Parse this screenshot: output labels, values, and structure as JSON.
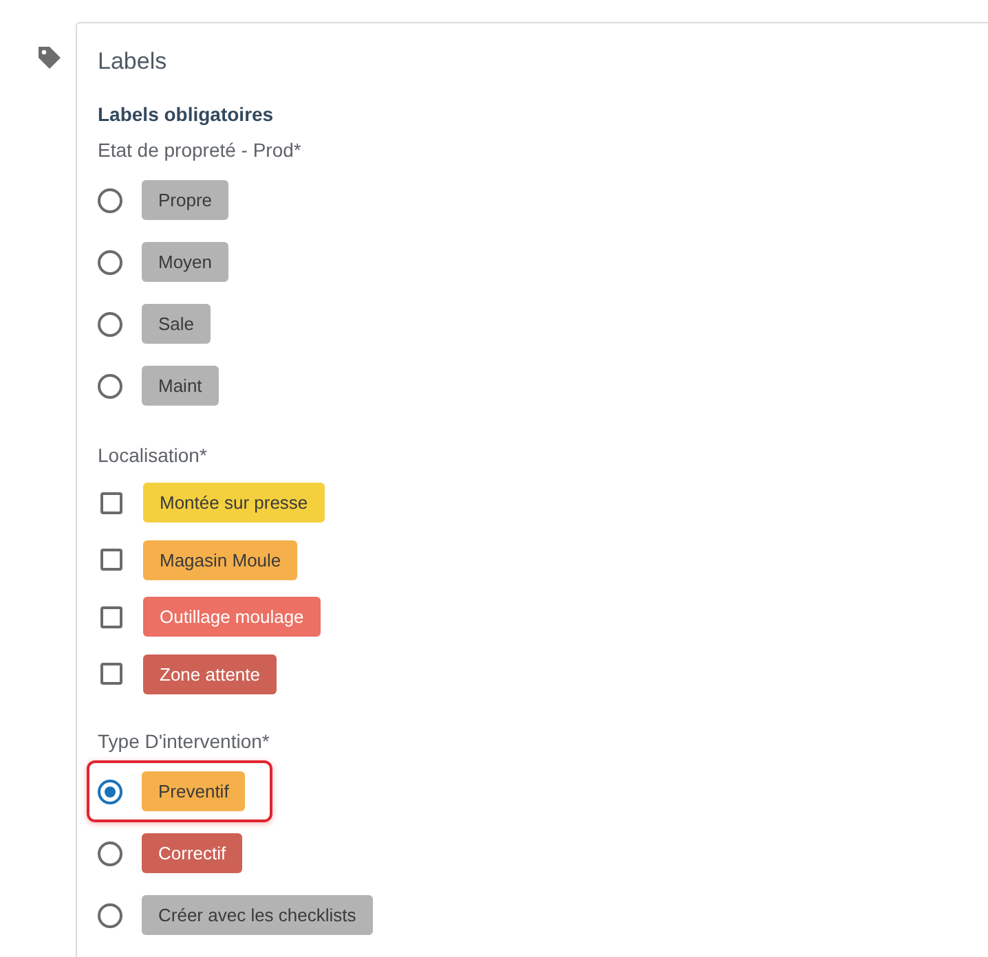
{
  "panel": {
    "title": "Labels",
    "subtitle": "Labels obligatoires"
  },
  "groups": [
    {
      "label": "Etat de propreté - Prod*",
      "kind": "radio",
      "options": [
        {
          "label": "Propre",
          "color": "#b3b3b3",
          "selected": false,
          "highlighted": false
        },
        {
          "label": "Moyen",
          "color": "#b3b3b3",
          "selected": false,
          "highlighted": false
        },
        {
          "label": "Sale",
          "color": "#b3b3b3",
          "selected": false,
          "highlighted": false
        },
        {
          "label": "Maint",
          "color": "#b3b3b3",
          "selected": false,
          "highlighted": false
        }
      ]
    },
    {
      "label": "Localisation*",
      "kind": "checkbox",
      "options": [
        {
          "label": "Montée sur presse",
          "color": "#f4d03f",
          "selected": false,
          "highlighted": false
        },
        {
          "label": "Magasin Moule",
          "color": "#f5b04c",
          "selected": false,
          "highlighted": false
        },
        {
          "label": "Outillage moulage",
          "color": "#ec7063",
          "selected": false,
          "highlighted": false
        },
        {
          "label": "Zone attente",
          "color": "#cd6155",
          "selected": false,
          "highlighted": false
        }
      ]
    },
    {
      "label": "Type D'intervention*",
      "kind": "radio",
      "options": [
        {
          "label": "Preventif",
          "color": "#f5b04c",
          "selected": true,
          "highlighted": true
        },
        {
          "label": "Correctif",
          "color": "#cd6155",
          "selected": false,
          "highlighted": false
        },
        {
          "label": "Créer avec les checklists",
          "color": "#b3b3b3",
          "selected": false,
          "highlighted": false
        }
      ]
    }
  ]
}
